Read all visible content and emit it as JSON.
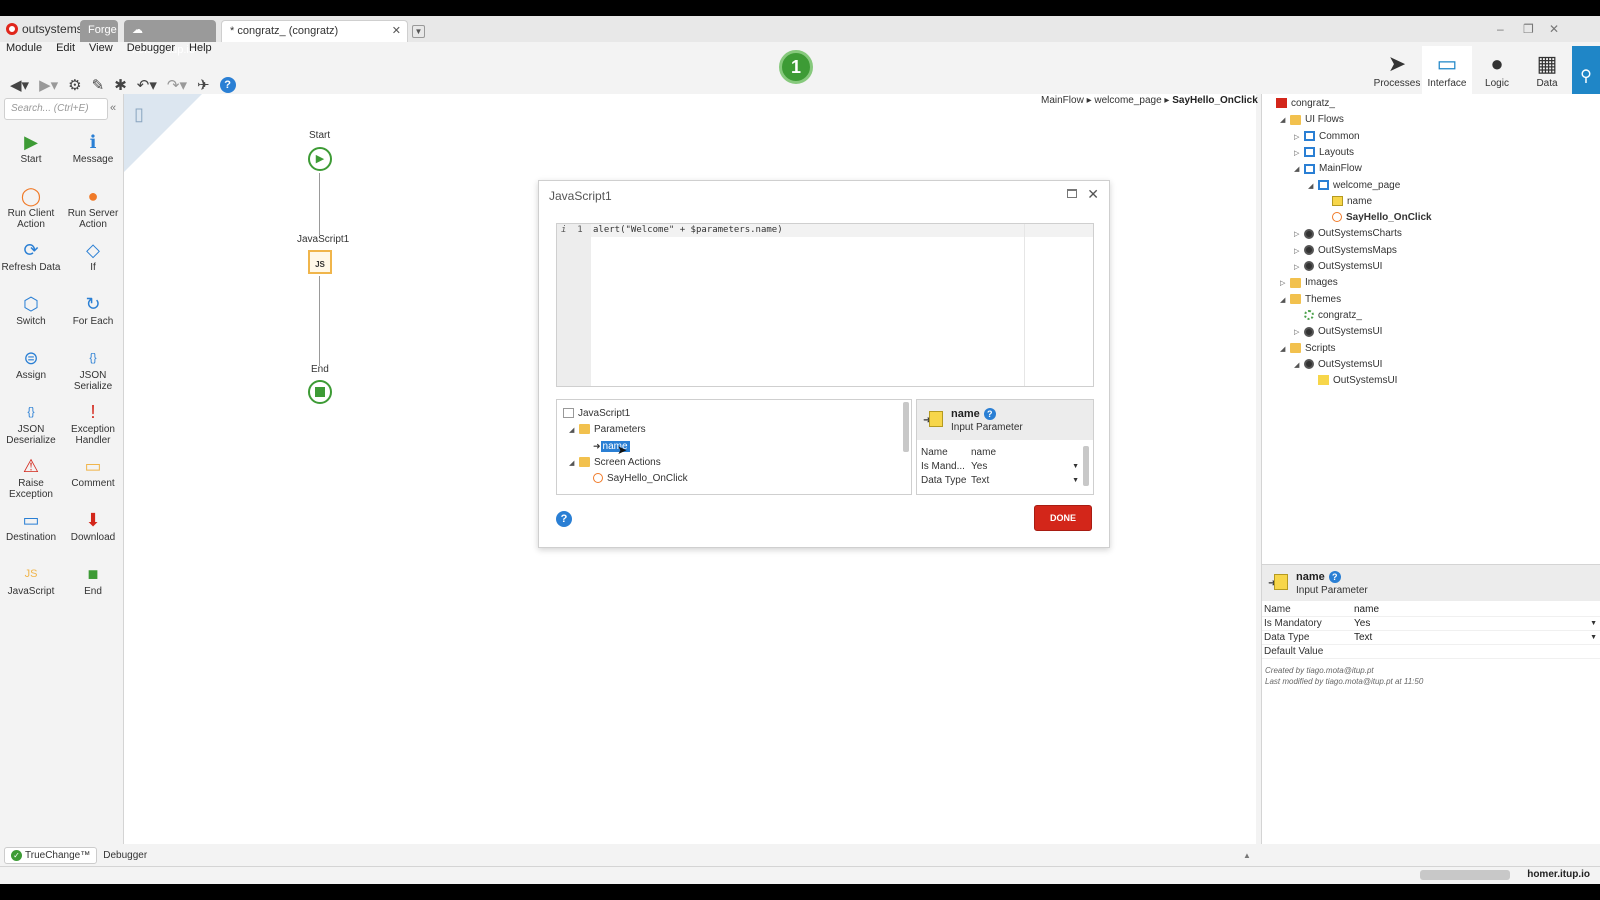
{
  "window": {
    "logo": "outsystems",
    "tabs": [
      {
        "label": "Forge"
      },
      {
        "label": "homer.itup.io"
      },
      {
        "label": "* congratz_ (congratz)"
      }
    ],
    "controls": [
      "–",
      "❐",
      "✕"
    ]
  },
  "menu": [
    "Module",
    "Edit",
    "View",
    "Debugger",
    "Help"
  ],
  "publish_badge": "1",
  "rightnav": [
    {
      "label": "Processes",
      "icon": "processes-icon"
    },
    {
      "label": "Interface",
      "icon": "interface-icon"
    },
    {
      "label": "Logic",
      "icon": "logic-icon"
    },
    {
      "label": "Data",
      "icon": "data-icon"
    }
  ],
  "toolbox": {
    "search_placeholder": "Search... (Ctrl+E)",
    "tools": [
      {
        "label": "Start",
        "icon": "▶",
        "color": "#3d9b35"
      },
      {
        "label": "Message",
        "icon": "ℹ",
        "color": "#2a7fd4"
      },
      {
        "label": "Run Client Action",
        "icon": "◯",
        "color": "#f07a28"
      },
      {
        "label": "Run Server Action",
        "icon": "●",
        "color": "#f07a28"
      },
      {
        "label": "Refresh Data",
        "icon": "⟳",
        "color": "#2a7fd4"
      },
      {
        "label": "If",
        "icon": "◇",
        "color": "#2a7fd4"
      },
      {
        "label": "Switch",
        "icon": "⬡",
        "color": "#2a7fd4"
      },
      {
        "label": "For Each",
        "icon": "↻",
        "color": "#2a7fd4"
      },
      {
        "label": "Assign",
        "icon": "⊜",
        "color": "#2a7fd4"
      },
      {
        "label": "JSON Serialize",
        "icon": "{}",
        "color": "#2a7fd4"
      },
      {
        "label": "JSON Deserialize",
        "icon": "{}",
        "color": "#2a7fd4"
      },
      {
        "label": "Exception Handler",
        "icon": "!",
        "color": "#d3261a"
      },
      {
        "label": "Raise Exception",
        "icon": "⚠",
        "color": "#d3261a"
      },
      {
        "label": "Comment",
        "icon": "▭",
        "color": "#f0b54b"
      },
      {
        "label": "Destination",
        "icon": "▭",
        "color": "#2a7fd4"
      },
      {
        "label": "Download",
        "icon": "⬇",
        "color": "#d3261a"
      },
      {
        "label": "JavaScript",
        "icon": "JS",
        "color": "#f0b54b"
      },
      {
        "label": "End",
        "icon": "■",
        "color": "#3d9b35"
      }
    ]
  },
  "canvas": {
    "breadcrumb": {
      "a": "MainFlow",
      "b": "welcome_page",
      "c": "SayHello_OnClick"
    },
    "nodes": {
      "start": "Start",
      "js": "JavaScript1",
      "js_glyph": "JS",
      "end": "End"
    }
  },
  "dialog": {
    "title": "JavaScript1",
    "code_line_no": "1",
    "code_marker": "i",
    "code": "alert(\"Welcome\" + $parameters.name)",
    "tree": {
      "root": "JavaScript1",
      "parameters": "Parameters",
      "param_name": "name",
      "screen_actions": "Screen Actions",
      "action": "SayHello_OnClick"
    },
    "props": {
      "name": "name",
      "kind": "Input Parameter",
      "rows": [
        {
          "k": "Name",
          "v": "name",
          "dd": false
        },
        {
          "k": "Is Mand...",
          "v": "Yes",
          "dd": true
        },
        {
          "k": "Data Type",
          "v": "Text",
          "dd": true
        }
      ]
    },
    "done_label": "DONE"
  },
  "tree": {
    "items": [
      {
        "label": "congratz_",
        "indent": 0,
        "arrow": "",
        "icon": "module",
        "bold": false
      },
      {
        "label": "UI Flows",
        "indent": 1,
        "arrow": "◢",
        "icon": "folder",
        "bold": false
      },
      {
        "label": "Common",
        "indent": 2,
        "arrow": "▷",
        "icon": "flow",
        "bold": false
      },
      {
        "label": "Layouts",
        "indent": 2,
        "arrow": "▷",
        "icon": "flow",
        "bold": false
      },
      {
        "label": "MainFlow",
        "indent": 2,
        "arrow": "◢",
        "icon": "flow",
        "bold": false
      },
      {
        "label": "welcome_page",
        "indent": 3,
        "arrow": "◢",
        "icon": "flow",
        "bold": false
      },
      {
        "label": "name",
        "indent": 4,
        "arrow": "",
        "icon": "param",
        "bold": false
      },
      {
        "label": "SayHello_OnClick",
        "indent": 4,
        "arrow": "",
        "icon": "action",
        "bold": true
      },
      {
        "label": "OutSystemsCharts",
        "indent": 2,
        "arrow": "▷",
        "icon": "circ",
        "bold": false
      },
      {
        "label": "OutSystemsMaps",
        "indent": 2,
        "arrow": "▷",
        "icon": "circ",
        "bold": false
      },
      {
        "label": "OutSystemsUI",
        "indent": 2,
        "arrow": "▷",
        "icon": "circ",
        "bold": false
      },
      {
        "label": "Images",
        "indent": 1,
        "arrow": "▷",
        "icon": "folder",
        "bold": false
      },
      {
        "label": "Themes",
        "indent": 1,
        "arrow": "◢",
        "icon": "folder",
        "bold": false
      },
      {
        "label": "congratz_",
        "indent": 2,
        "arrow": "",
        "icon": "theme",
        "bold": false
      },
      {
        "label": "OutSystemsUI",
        "indent": 2,
        "arrow": "▷",
        "icon": "circ",
        "bold": false
      },
      {
        "label": "Scripts",
        "indent": 1,
        "arrow": "◢",
        "icon": "folder",
        "bold": false
      },
      {
        "label": "OutSystemsUI",
        "indent": 2,
        "arrow": "◢",
        "icon": "circ",
        "bold": false
      },
      {
        "label": "OutSystemsUI",
        "indent": 3,
        "arrow": "",
        "icon": "js",
        "bold": false
      }
    ]
  },
  "props": {
    "name": "name",
    "kind": "Input Parameter",
    "rows": [
      {
        "k": "Name",
        "v": "name",
        "dd": false
      },
      {
        "k": "Is Mandatory",
        "v": "Yes",
        "dd": true
      },
      {
        "k": "Data Type",
        "v": "Text",
        "dd": true
      },
      {
        "k": "Default Value",
        "v": "",
        "dd": false
      }
    ],
    "created": "Created by tiago.mota@itup.pt",
    "modified": "Last modified by tiago.mota@itup.pt at 11:50"
  },
  "bottom": {
    "truechange": "TrueChange™",
    "debugger": "Debugger"
  },
  "status": {
    "host": "homer.itup.io"
  }
}
